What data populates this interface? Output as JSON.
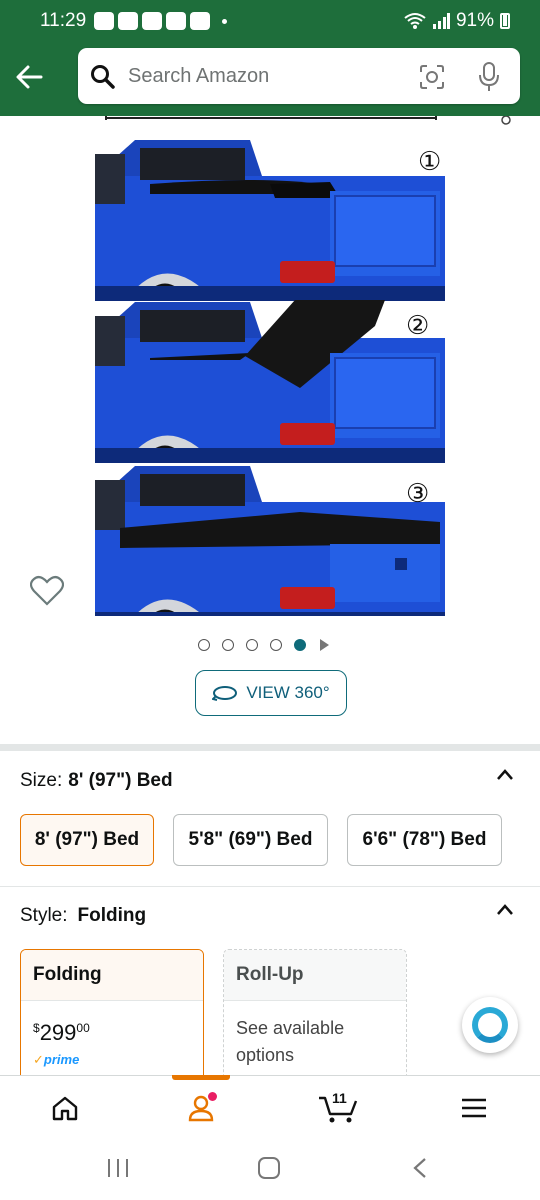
{
  "status_bar": {
    "time": "11:29",
    "battery": "91%"
  },
  "search": {
    "placeholder": "Search Amazon"
  },
  "gallery": {
    "steps": [
      "①",
      "②",
      "③"
    ],
    "dots_total": 5,
    "active_dot": 5,
    "view360_label": "VIEW 360°",
    "truck_color": "#1a47c8"
  },
  "size_section": {
    "label": "Size:",
    "selected": "8' (97\") Bed",
    "options": [
      "8' (97\") Bed",
      "5'8\" (69\") Bed",
      "6'6\" (78\") Bed"
    ]
  },
  "style_section": {
    "label": "Style:",
    "selected": "Folding",
    "cards": [
      {
        "name": "Folding",
        "price_symbol": "$",
        "price_whole": "299",
        "price_fraction": "00",
        "badge": "prime"
      },
      {
        "name": "Roll-Up",
        "text": "See available options"
      }
    ]
  },
  "bottom_nav": {
    "cart_count": "11"
  },
  "colors": {
    "header_green": "#1e6e3b",
    "accent_orange": "#e77600",
    "teal": "#0f6b7a"
  }
}
